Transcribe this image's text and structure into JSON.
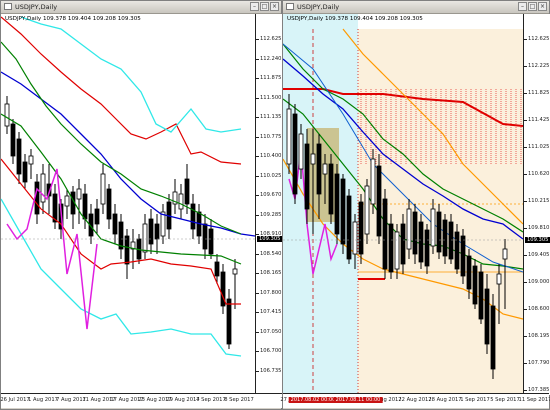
{
  "left": {
    "title": "USDJPY,Daily",
    "symbol_line": "USDJPY,Daily  109.378 109.404 109.208 109.305",
    "price_tag": "109.305",
    "yticks": [
      "112.625",
      "112.240",
      "111.875",
      "111.500",
      "111.135",
      "110.775",
      "110.400",
      "110.025",
      "109.670",
      "109.285",
      "108.910",
      "108.540",
      "108.165",
      "107.800",
      "107.415",
      "107.050",
      "106.700",
      "106.735"
    ],
    "xticks": [
      "26 Jul 2017",
      "1 Aug 2017",
      "7 Aug 2017",
      "11 Aug 2017",
      "17 Aug 2017",
      "23 Aug 2017",
      "29 Aug 2017",
      "4 Sep 2017",
      "8 Sep 2017"
    ]
  },
  "right": {
    "title": "USDJPY,Daily",
    "symbol_line": "USDJPY,Daily  109.378 109.404 109.208 109.305",
    "price_tag": "109.305",
    "yticks": [
      "112.625",
      "112.225",
      "111.825",
      "111.425",
      "111.025",
      "110.620",
      "110.215",
      "109.810",
      "109.405",
      "109.000",
      "108.600",
      "108.195",
      "107.790",
      "107.385"
    ],
    "xticks": [
      "27 Jul 2017",
      "4 Aug 2017",
      "10 Aug 2017",
      "16 Aug 2017",
      "22 Aug 2017",
      "28 Aug 2017",
      "1 Sep 2017",
      "5 Sep 2017",
      "11 Sep 2017"
    ],
    "highlight_dates": [
      "2017.08.02 00:00",
      "2017.08.11 00:00"
    ]
  },
  "colors": {
    "bull": "#ffffff",
    "bear": "#000000",
    "ma_blue": "#0000d0",
    "ma_green": "#008000",
    "ma_red": "#e00000",
    "band_cyan": "#30e8e8",
    "rsi_magenta": "#e020e0",
    "orange": "#ff9900",
    "highlight": "#c81414"
  }
}
